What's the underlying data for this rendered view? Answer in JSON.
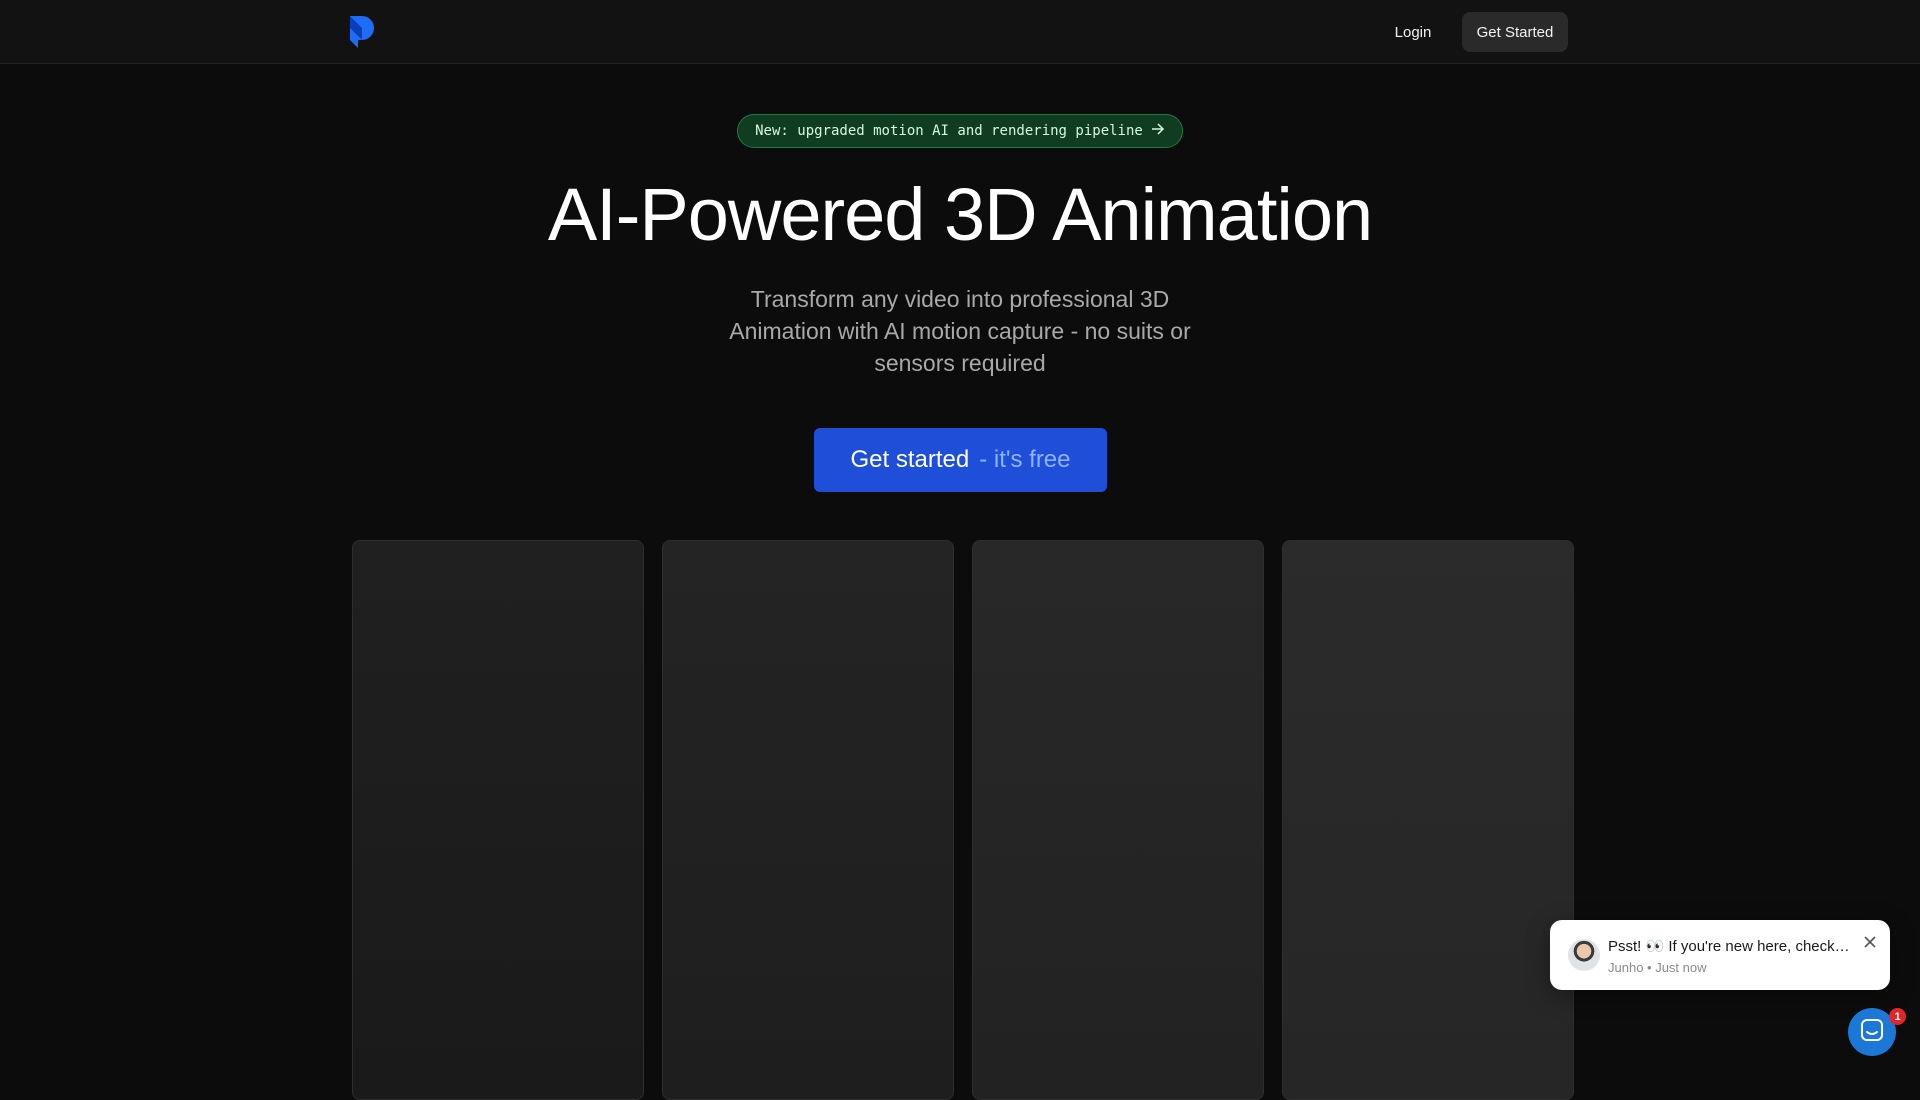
{
  "nav": {
    "login_label": "Login",
    "cta_label": "Get Started",
    "logo_icon": "brand-logo-icon"
  },
  "announcement": {
    "text": "New: upgraded motion AI and rendering pipeline",
    "icon": "arrow-right-icon"
  },
  "hero": {
    "title": "AI-Powered 3D Animation",
    "subtitle": "Transform any video into professional 3D Animation with AI motion capture - no suits or sensors required",
    "cta_main": "Get started",
    "cta_suffix": "- it's free"
  },
  "chat": {
    "message": "Psst! 👀 If you're new here, check out our quick start guide",
    "sender": "Junho",
    "time": "Just now",
    "meta": "Junho • Just now",
    "badge_count": "1",
    "close_icon": "close-icon",
    "launcher_icon": "chat-icon"
  },
  "colors": {
    "background": "#0c0c0c",
    "accent": "#1f4fd8",
    "announcement_bg": "#103c22",
    "launcher": "#1b78d6",
    "badge": "#e0262b"
  }
}
